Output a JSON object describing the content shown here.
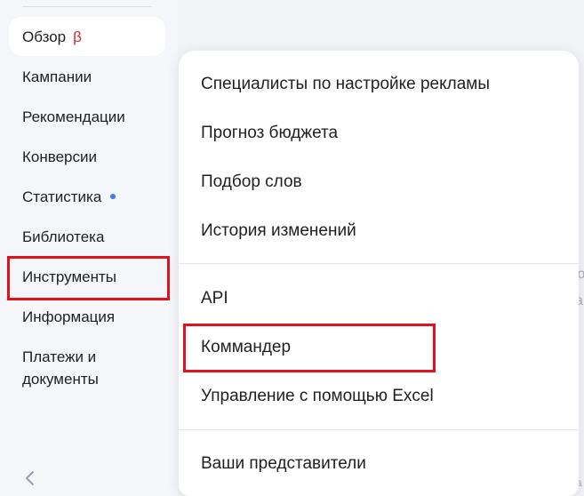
{
  "sidebar": {
    "items": [
      {
        "label": "Обзор",
        "badge": "β"
      },
      {
        "label": "Кампании"
      },
      {
        "label": "Рекомендации"
      },
      {
        "label": "Конверсии"
      },
      {
        "label": "Статистика"
      },
      {
        "label": "Библиотека"
      },
      {
        "label": "Инструменты"
      },
      {
        "label": "Информация"
      },
      {
        "label": "Платежи и"
      },
      {
        "label": "документы"
      }
    ],
    "collapse_icon": "chevron-left-icon"
  },
  "tools_menu": {
    "items": [
      {
        "label": "Специалисты по настройке рекламы"
      },
      {
        "label": "Прогноз бюджета"
      },
      {
        "label": "Подбор слов"
      },
      {
        "label": "История изменений"
      },
      {
        "label": "API"
      },
      {
        "label": "Коммандер"
      },
      {
        "label": "Управление с помощью Excel"
      },
      {
        "label": "Ваши представители"
      }
    ]
  },
  "background": {
    "fragments": [
      "lo",
      "a",
      "а"
    ]
  },
  "colors": {
    "accent_red": "#e1121b",
    "beta_red": "#d9262b",
    "dot_blue": "#3e7fe0"
  }
}
